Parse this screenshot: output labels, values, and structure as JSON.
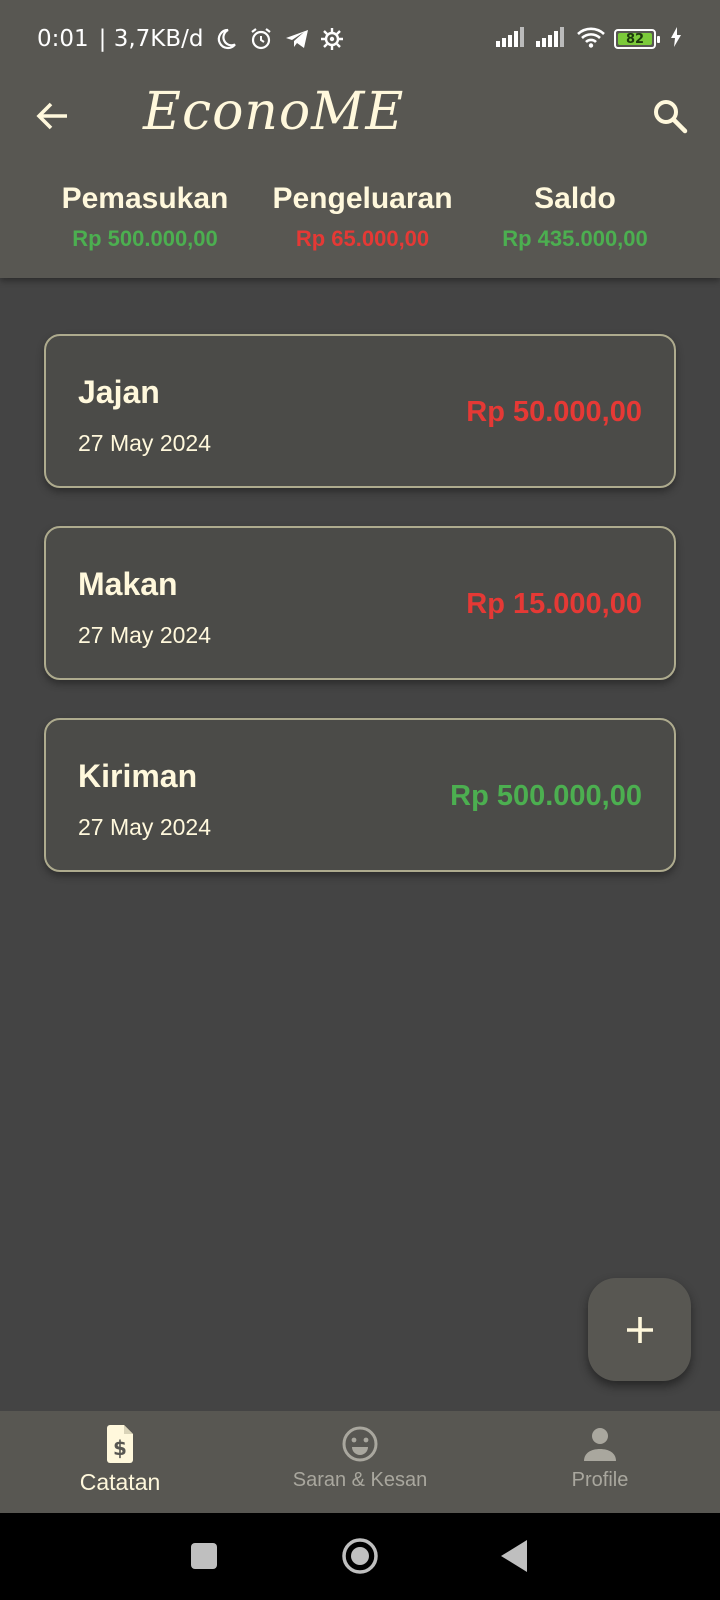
{
  "status_bar": {
    "time": "0:01",
    "network_speed": "| 3,7KB/d",
    "battery_level": "82",
    "icons": [
      "moon-icon",
      "alarm-icon",
      "telegram-icon",
      "settings-gear-icon",
      "signal-icon",
      "signal-icon",
      "wifi-icon",
      "battery-icon",
      "charging-icon"
    ]
  },
  "app_bar": {
    "title": "EconoME",
    "back_icon": "arrow-left-icon",
    "search_icon": "search-icon"
  },
  "summary": {
    "income_label": "Pemasukan",
    "income_value": "Rp 500.000,00",
    "expense_label": "Pengeluaran",
    "expense_value": "Rp 65.000,00",
    "balance_label": "Saldo",
    "balance_value": "Rp 435.000,00"
  },
  "transactions": [
    {
      "name": "Jajan",
      "date": "27 May 2024",
      "amount": "Rp 50.000,00",
      "type": "expense"
    },
    {
      "name": "Makan",
      "date": "27 May 2024",
      "amount": "Rp 15.000,00",
      "type": "expense"
    },
    {
      "name": "Kiriman",
      "date": "27 May 2024",
      "amount": "Rp 500.000,00",
      "type": "income"
    }
  ],
  "fab": {
    "icon": "plus-icon"
  },
  "bottom_nav": {
    "items": [
      {
        "label": "Catatan",
        "icon": "receipt-icon",
        "active": true
      },
      {
        "label": "Saran & Kesan",
        "icon": "smiley-icon",
        "active": false
      },
      {
        "label": "Profile",
        "icon": "person-icon",
        "active": false
      }
    ]
  },
  "colors": {
    "app_bar": "#585752",
    "background": "#444444",
    "card": "#4B4B48",
    "card_border": "#AEAB8E",
    "text_primary": "#FFF8DC",
    "income_green": "#4CAF50",
    "expense_red": "#E53935"
  }
}
